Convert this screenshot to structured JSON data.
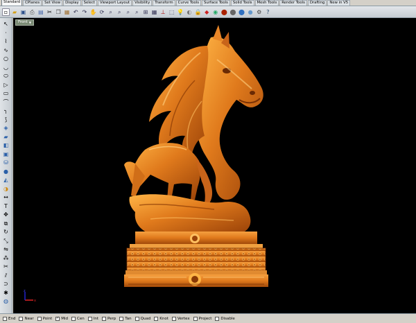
{
  "tabs": [
    "Standard",
    "CPlanes",
    "Set View",
    "Display",
    "Select",
    "Viewport Layout",
    "Visibility",
    "Transform",
    "Curve Tools",
    "Surface Tools",
    "Solid Tools",
    "Mesh Tools",
    "Render Tools",
    "Drafting",
    "New in V5"
  ],
  "active_tab": "Standard",
  "viewport": {
    "label": "Front"
  },
  "osnaps": [
    {
      "label": "End",
      "checked": false
    },
    {
      "label": "Near",
      "checked": false
    },
    {
      "label": "Point",
      "checked": false
    },
    {
      "label": "Mid",
      "checked": true
    },
    {
      "label": "Cen",
      "checked": false
    },
    {
      "label": "Int",
      "checked": false
    },
    {
      "label": "Perp",
      "checked": false
    },
    {
      "label": "Tan",
      "checked": false
    },
    {
      "label": "Quad",
      "checked": false
    },
    {
      "label": "Knot",
      "checked": false
    },
    {
      "label": "Vertex",
      "checked": false
    },
    {
      "label": "Project",
      "checked": false
    },
    {
      "label": "Disable",
      "checked": false
    }
  ],
  "colors": {
    "model": "#e07a1c",
    "model_highlight": "#ffc060",
    "model_shadow": "#7a3206",
    "viewport_bg": "#000000"
  }
}
